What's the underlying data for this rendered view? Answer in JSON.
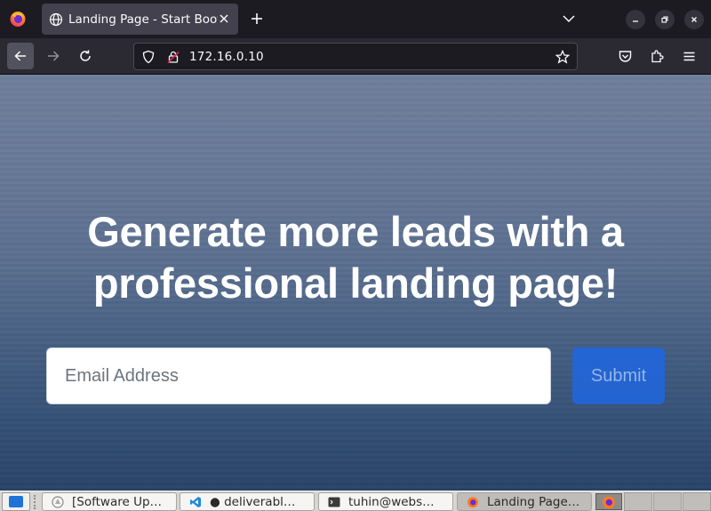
{
  "browser": {
    "tab": {
      "title": "Landing Page - Start Bootstrap Theme"
    },
    "url": "172.16.0.10"
  },
  "page": {
    "headline": "Generate more leads with a professional landing page!",
    "email_placeholder": "Email Address",
    "submit_label": "Submit"
  },
  "taskbar": {
    "tasks": [
      {
        "label": "[Software Up…",
        "icon": "software-updater-icon"
      },
      {
        "label": "● deliverabl…",
        "icon": "vscode-icon"
      },
      {
        "label": "tuhin@webs…",
        "icon": "terminal-icon"
      },
      {
        "label": "Landing Page…",
        "icon": "firefox-icon"
      }
    ]
  },
  "colors": {
    "accent": "#2166d9",
    "toolbar": "#2b2a33",
    "tabstrip": "#1c1b22"
  }
}
